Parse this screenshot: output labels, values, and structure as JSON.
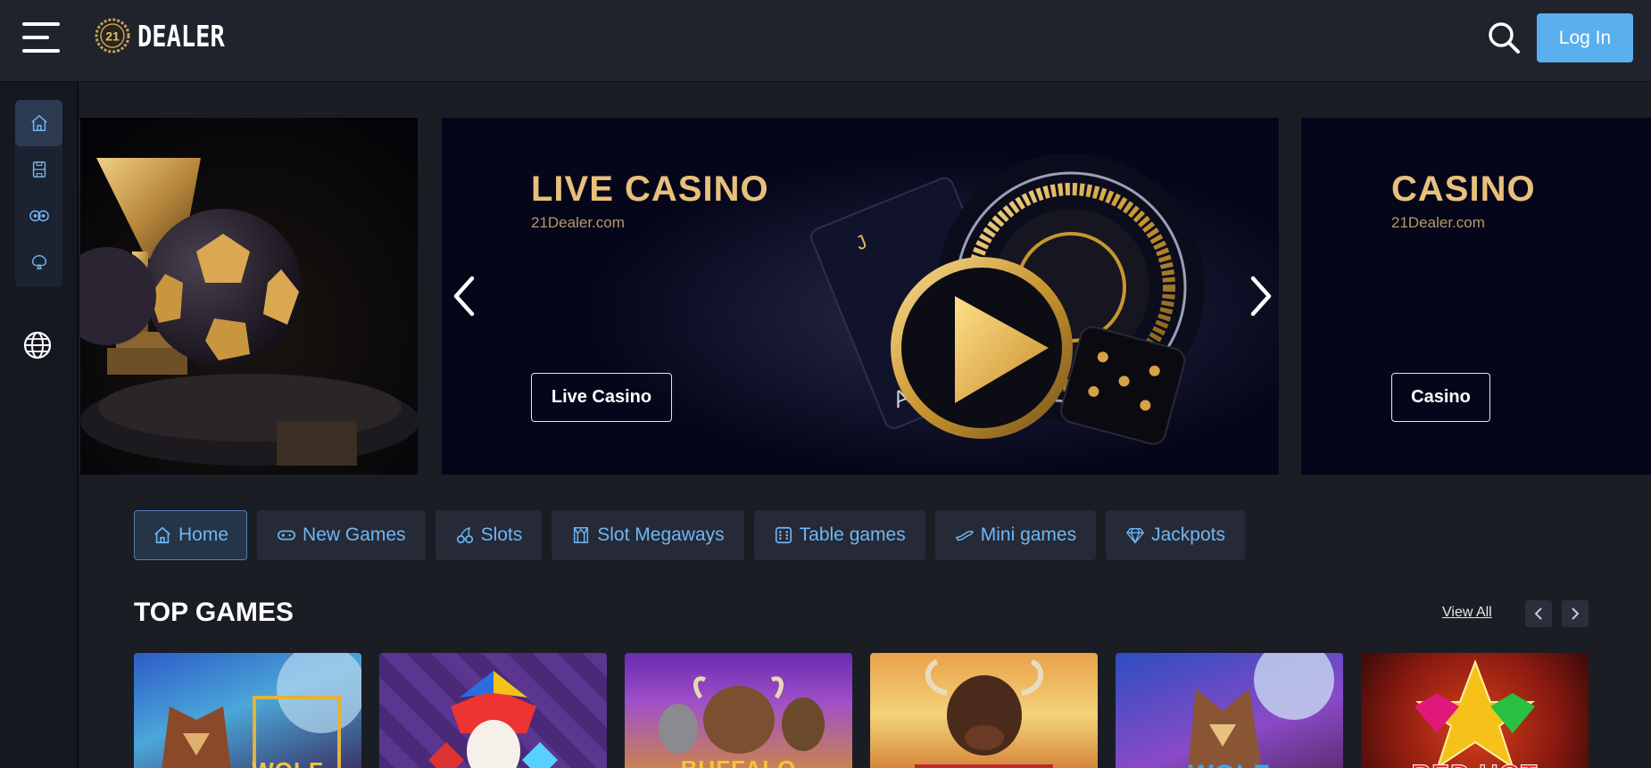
{
  "header": {
    "logo_number": "21",
    "logo_text": "DEALER",
    "login_label": "Log In"
  },
  "sidebar": {
    "items": [
      {
        "icon": "home-icon",
        "active": true
      },
      {
        "icon": "sports-icon",
        "active": false
      },
      {
        "icon": "live-casino-icon",
        "active": false
      },
      {
        "icon": "casino-icon",
        "active": false
      }
    ],
    "language_icon": "globe-icon"
  },
  "banners": [
    {
      "title": "",
      "subtitle": "",
      "button": ""
    },
    {
      "title": "LIVE CASINO",
      "subtitle": "21Dealer.com",
      "button": "Live Casino"
    },
    {
      "title": "CASINO",
      "subtitle": "21Dealer.com",
      "button": "Casino"
    }
  ],
  "tabs": [
    {
      "label": "Home",
      "icon": "home-icon",
      "active": true
    },
    {
      "label": "New Games",
      "icon": "gamepad-icon",
      "active": false
    },
    {
      "label": "Slots",
      "icon": "cherries-icon",
      "active": false
    },
    {
      "label": "Slot Megaways",
      "icon": "megaways-icon",
      "active": false
    },
    {
      "label": "Table games",
      "icon": "dice-icon",
      "active": false
    },
    {
      "label": "Mini games",
      "icon": "plane-icon",
      "active": false
    },
    {
      "label": "Jackpots",
      "icon": "diamond-icon",
      "active": false
    }
  ],
  "top_games": {
    "title": "TOP GAMES",
    "view_all": "View All",
    "games": [
      {
        "label": "WOLF"
      },
      {
        "label": ""
      },
      {
        "label": "BUFFALO"
      },
      {
        "label": ""
      },
      {
        "label": "WOLF"
      },
      {
        "label": "RED HOT"
      }
    ]
  },
  "colors": {
    "accent": "#5aafee",
    "gold": "#e9c07a",
    "background": "#1a1d24",
    "tab_text": "#6fb6f5"
  }
}
